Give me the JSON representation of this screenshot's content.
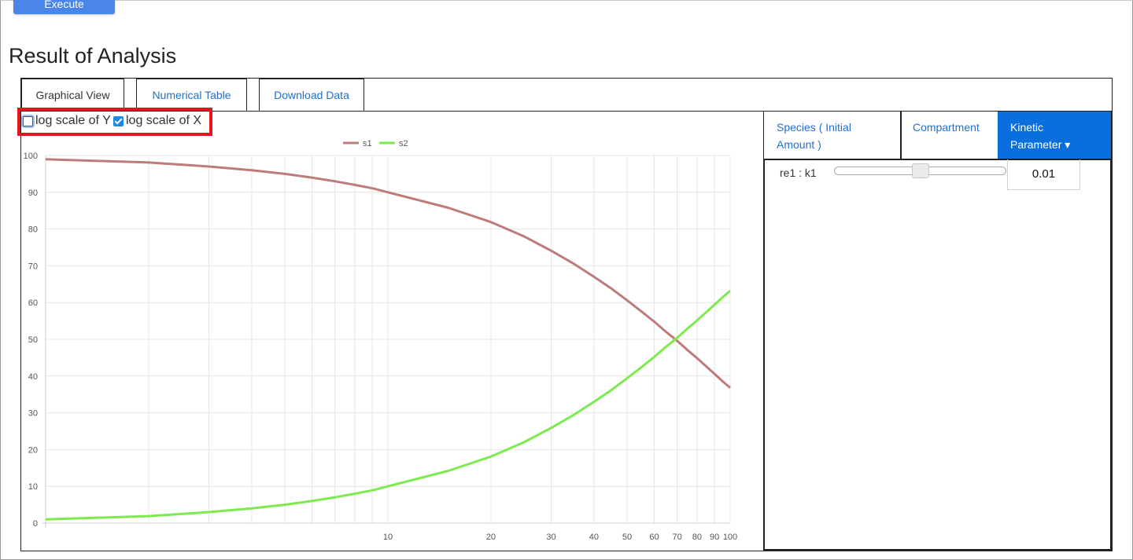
{
  "header": {
    "execute_label": "Execute",
    "title": "Result of Analysis"
  },
  "tabs": [
    {
      "label": "Graphical View",
      "active": true
    },
    {
      "label": "Numerical Table",
      "active": false
    },
    {
      "label": "Download Data",
      "active": false
    }
  ],
  "options": {
    "log_y": {
      "label": "log scale of Y",
      "checked": false
    },
    "log_x": {
      "label": "log scale of X",
      "checked": true
    }
  },
  "chart_data": {
    "type": "line",
    "x_scale": "log",
    "y_scale": "linear",
    "xlim": [
      1,
      100
    ],
    "ylim": [
      0,
      100
    ],
    "x_tick_labels": [
      "10",
      "20",
      "30",
      "40",
      "50",
      "60",
      "70",
      "80",
      "90",
      "100"
    ],
    "y_tick_labels": [
      "0",
      "10",
      "20",
      "30",
      "40",
      "50",
      "60",
      "70",
      "80",
      "90",
      "100"
    ],
    "grid": true,
    "legend_position": "top-center",
    "series": [
      {
        "name": "s1",
        "color": "#bd7b7b",
        "x": [
          1,
          2,
          3,
          4,
          5,
          6,
          7,
          8,
          9,
          10,
          15,
          20,
          25,
          30,
          35,
          40,
          45,
          50,
          55,
          60,
          65,
          70,
          75,
          80,
          85,
          90,
          95,
          100
        ],
        "y": [
          99,
          98.1,
          97,
          96,
          95,
          94,
          93,
          92,
          91.1,
          90,
          85.8,
          81.9,
          78,
          74.1,
          70.5,
          67,
          63.8,
          60.6,
          57.6,
          54.8,
          52,
          49.6,
          47.1,
          44.9,
          42.7,
          40.6,
          38.6,
          36.8
        ]
      },
      {
        "name": "s2",
        "color": "#7dea4f",
        "x": [
          1,
          2,
          3,
          4,
          5,
          6,
          7,
          8,
          9,
          10,
          15,
          20,
          25,
          30,
          35,
          40,
          45,
          50,
          55,
          60,
          65,
          70,
          75,
          80,
          85,
          90,
          95,
          100
        ],
        "y": [
          1,
          1.9,
          3,
          4,
          5,
          6,
          7,
          8,
          8.9,
          10,
          14.2,
          18.1,
          22,
          25.9,
          29.5,
          33,
          36.2,
          39.4,
          42.4,
          45.2,
          48,
          50.4,
          52.9,
          55.1,
          57.3,
          59.4,
          61.4,
          63.2
        ]
      }
    ]
  },
  "side": {
    "tabs": [
      {
        "label_line1": "Species ( Initial",
        "label_line2": "Amount )",
        "selected": false
      },
      {
        "label_line1": "Compartment",
        "label_line2": "",
        "selected": false
      },
      {
        "label_line1": "Kinetic",
        "label_line2": "Parameter ▾",
        "selected": true
      }
    ],
    "param": {
      "label": "re1 : k1",
      "value": "0.01",
      "slider_fraction": 0.5
    }
  }
}
